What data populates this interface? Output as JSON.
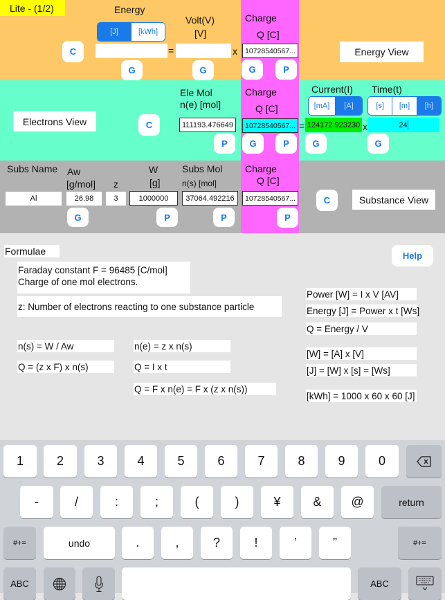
{
  "badge": "Lite - (1/2)",
  "energy_section": {
    "energy_label": "Energy",
    "energy_units": [
      "[J]",
      "[kWh]"
    ],
    "energy_unit_selected": "[J]",
    "energy_value": "",
    "volt_label": "Volt(V)",
    "volt_unit": "[V]",
    "volt_value": "",
    "equals": "=",
    "times": "x",
    "clear_label": "C",
    "energy_g_label": "G",
    "volt_g_label": "G",
    "view_label": "Energy View"
  },
  "charge_column": {
    "label": "Charge",
    "unit": "Q [C]",
    "value": "10728540567...",
    "g_label": "G",
    "p_label": "P"
  },
  "electrons_section": {
    "view_label": "Electrons View",
    "clear_label": "C",
    "ele_mol_label": "Ele Mol",
    "ele_mol_unit": "n(e) [mol]",
    "ele_mol_value": "111193.476649",
    "ele_mol_p_label": "P",
    "equals": "=",
    "times": "x",
    "current_label": "Current(I)",
    "current_units": [
      "[mA]",
      "[A]"
    ],
    "current_unit_selected": "[A]",
    "current_value": "124172.923230",
    "current_g_label": "G",
    "time_label": "Time(t)",
    "time_units": [
      "[s]",
      "[m]",
      "[h]"
    ],
    "time_unit_selected": "[h]",
    "time_value": "24",
    "time_g_label": "G"
  },
  "substance_section": {
    "subs_name_label": "Subs Name",
    "subs_name_value": "Al",
    "aw_label": "Aw",
    "aw_unit": "[g/mol]",
    "aw_value": "26.98",
    "aw_g_label": "G",
    "z_label": "z",
    "z_value": "3",
    "w_label": "W",
    "w_unit": "[g]",
    "w_value": "1000000",
    "w_p_label": "P",
    "subs_mol_label": "Subs Mol",
    "subs_mol_unit": "n(s) [mol]",
    "subs_mol_value": "37064.492216",
    "subs_mol_p_label": "P",
    "clear_label": "C",
    "view_label": "Substance View"
  },
  "formulae": {
    "title": "Formulae",
    "help_label": "Help",
    "faraday_line1": "Faraday constant  F = 96485 [C/mol]",
    "faraday_line2": "Charge of one mol electrons.",
    "z_desc": "z: Number of electrons reacting to one substance particle",
    "left_col": [
      "n(s) = W / Aw",
      "Q = (z x F) x n(s)"
    ],
    "mid_col": [
      "n(e) = z x n(s)",
      "Q = I x t",
      "Q = F x n(e) = F x (z x n(s))"
    ],
    "right_col": [
      "Power [W] = I x V  [AV]",
      "Energy [J] =  Power x t  [Ws]",
      "Q = Energy  / V",
      "[W] = [A] x [V]",
      "[J] = [W] x [s] = [Ws]",
      "[kWh] = 1000 x 60 x 60 [J]"
    ]
  },
  "keyboard": {
    "row1": [
      "1",
      "2",
      "3",
      "4",
      "5",
      "6",
      "7",
      "8",
      "9",
      "0"
    ],
    "delete_icon": "backspace-icon",
    "row2": [
      "-",
      "/",
      ":",
      ";",
      "(",
      ")",
      "¥",
      "&",
      "@"
    ],
    "return_label": "return",
    "row3_left": "#+=",
    "undo_label": "undo",
    "row3": [
      ".",
      ",",
      "?",
      "!",
      "’",
      "”"
    ],
    "row3_right": "#+=",
    "abc_left": "ABC",
    "globe_icon": "globe-icon",
    "mic_icon": "microphone-icon",
    "space_label": "",
    "abc_right": "ABC",
    "hide_icon": "keyboard-hide-icon"
  },
  "colors": {
    "energy_bg": "#fdc865",
    "electrons_bg": "#66ffcc",
    "substance_bg": "#b2b2b2",
    "charge_bg": "#ff66ff",
    "badge_bg": "#ffff00",
    "accent": "#1a7ae8",
    "current_field_bg": "#00ee00",
    "time_field_bg": "#00ffff"
  }
}
